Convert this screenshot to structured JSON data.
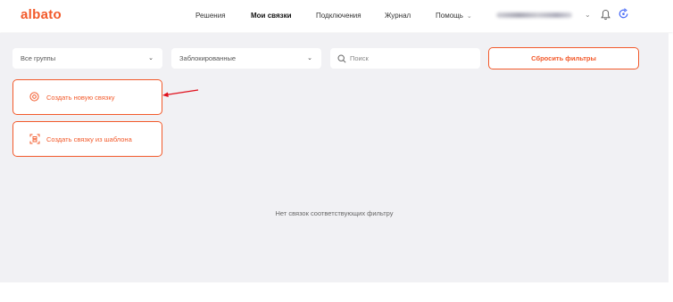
{
  "app": {
    "logo": "albato"
  },
  "nav": {
    "items": [
      {
        "label": "Решения"
      },
      {
        "label": "Мои связки"
      },
      {
        "label": "Подключения"
      },
      {
        "label": "Журнал"
      },
      {
        "label": "Помощь"
      }
    ]
  },
  "header": {
    "bell_icon": "bell-icon",
    "update_icon": "refresh-badge-icon"
  },
  "filters": {
    "groups_value": "Все группы",
    "status_value": "Заблокированные",
    "search_placeholder": "Поиск",
    "reset_label": "Сбросить фильтры"
  },
  "actions": {
    "create_new_label": "Создать новую связку",
    "create_from_template_label": "Создать связку из шаблона"
  },
  "empty_state": {
    "message": "Нет связок соответствующих фильтру"
  },
  "colors": {
    "accent": "#f2592a",
    "background": "#f1f1f4",
    "annotation_arrow": "#e0101c"
  }
}
